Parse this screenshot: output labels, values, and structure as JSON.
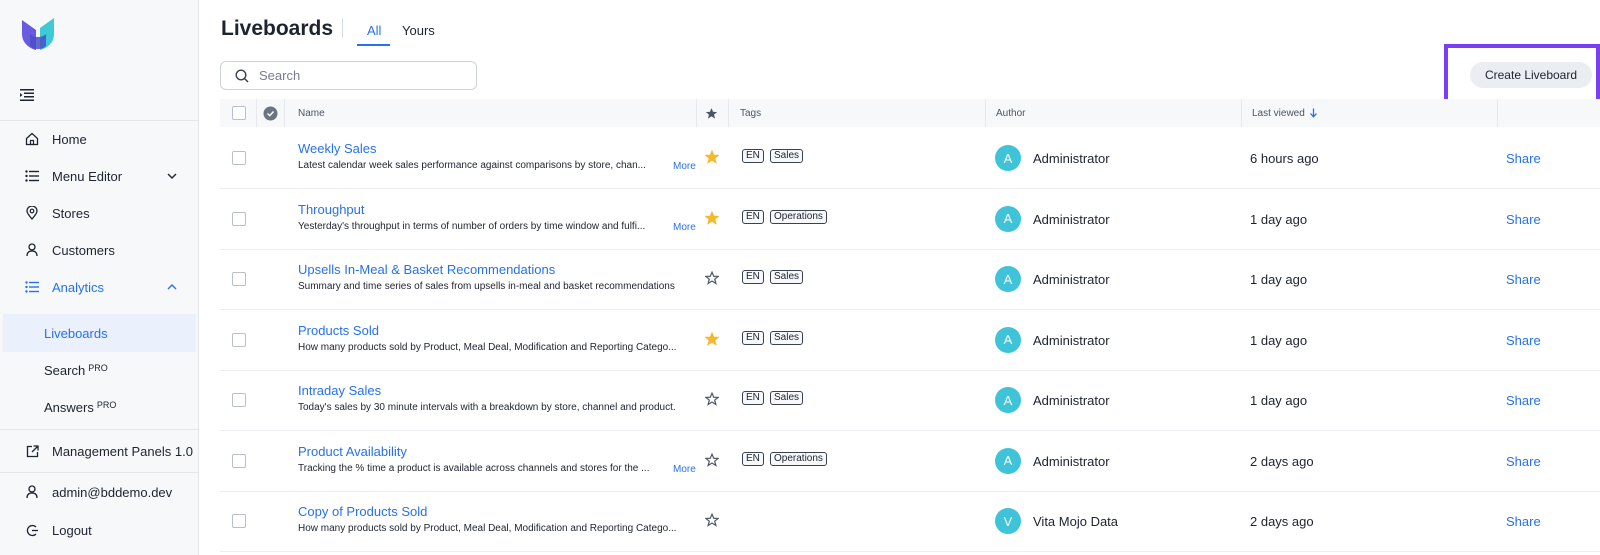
{
  "sidebar": {
    "nav": [
      {
        "label": "Home",
        "icon": "home-icon"
      },
      {
        "label": "Menu Editor",
        "icon": "list-icon"
      },
      {
        "label": "Stores",
        "icon": "location-pin-icon"
      },
      {
        "label": "Customers",
        "icon": "user-icon"
      },
      {
        "label": "Analytics",
        "icon": "list-icon"
      }
    ],
    "analytics_sub": [
      {
        "label": "Liveboards",
        "badge": ""
      },
      {
        "label": "Search",
        "badge": "PRO"
      },
      {
        "label": "Answers",
        "badge": "PRO"
      }
    ],
    "management": "Management Panels 1.0",
    "account": "admin@bddemo.dev",
    "logout": "Logout"
  },
  "header": {
    "title": "Liveboards",
    "tabs": [
      "All",
      "Yours"
    ],
    "search_placeholder": "Search",
    "create_label": "Create Liveboard"
  },
  "table": {
    "columns": {
      "name": "Name",
      "tags": "Tags",
      "author": "Author",
      "last_viewed": "Last viewed"
    },
    "rows": [
      {
        "name": "Weekly Sales",
        "desc": "Latest calendar week sales performance against comparisons by store, chan...",
        "more": "More",
        "starred": true,
        "tags": [
          "EN",
          "Sales"
        ],
        "avatar": "A",
        "author": "Administrator",
        "viewed": "6 hours ago",
        "share": "Share"
      },
      {
        "name": "Throughput",
        "desc": "Yesterday's throughput in terms of number of orders by time window and fulfi...",
        "more": "More",
        "starred": true,
        "tags": [
          "EN",
          "Operations"
        ],
        "avatar": "A",
        "author": "Administrator",
        "viewed": "1 day ago",
        "share": "Share"
      },
      {
        "name": "Upsells In-Meal & Basket Recommendations",
        "desc": "Summary and time series of sales from upsells in-meal and basket recommendations",
        "more": "",
        "starred": false,
        "tags": [
          "EN",
          "Sales"
        ],
        "avatar": "A",
        "author": "Administrator",
        "viewed": "1 day ago",
        "share": "Share"
      },
      {
        "name": "Products Sold",
        "desc": "How many products sold by Product, Meal Deal, Modification and Reporting Catego...",
        "more": "",
        "starred": true,
        "tags": [
          "EN",
          "Sales"
        ],
        "avatar": "A",
        "author": "Administrator",
        "viewed": "1 day ago",
        "share": "Share"
      },
      {
        "name": "Intraday Sales",
        "desc": "Today's sales by 30 minute intervals with a breakdown by store, channel and product.",
        "more": "",
        "starred": false,
        "tags": [
          "EN",
          "Sales"
        ],
        "avatar": "A",
        "author": "Administrator",
        "viewed": "1 day ago",
        "share": "Share"
      },
      {
        "name": "Product Availability",
        "desc": "Tracking the % time a product is available across channels and stores for the ...",
        "more": "More",
        "starred": false,
        "tags": [
          "EN",
          "Operations"
        ],
        "avatar": "A",
        "author": "Administrator",
        "viewed": "2 days ago",
        "share": "Share"
      },
      {
        "name": "Copy of Products Sold",
        "desc": "How many products sold by Product, Meal Deal, Modification and Reporting Catego...",
        "more": "",
        "starred": false,
        "tags": [],
        "avatar": "V",
        "author": "Vita Mojo Data",
        "viewed": "2 days ago",
        "share": "Share"
      }
    ]
  },
  "colors": {
    "accent": "#2770ef",
    "highlight": "#7b3ff2",
    "avatar": "#3fc3d9",
    "star": "#f5b92e"
  }
}
